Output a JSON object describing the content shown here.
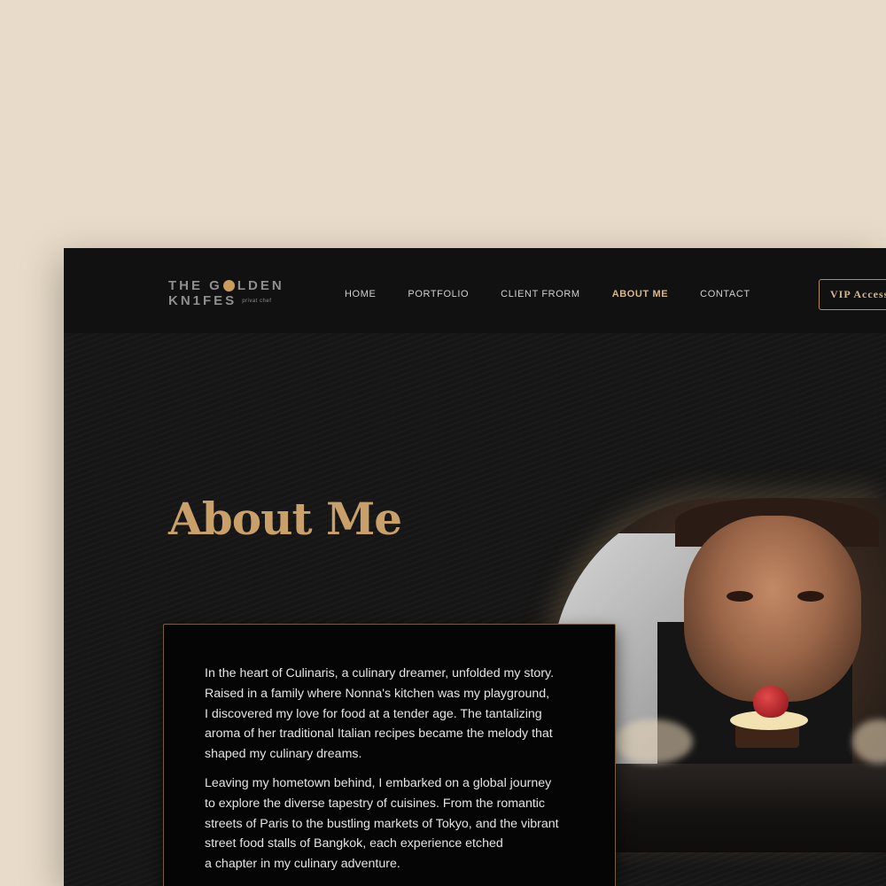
{
  "logo": {
    "line1_before": "THE G",
    "line1_after": "LDEN",
    "line2": "KN1FES",
    "subtitle": "privat chef"
  },
  "nav": {
    "items": [
      {
        "label": "HOME",
        "active": false
      },
      {
        "label": "PORTFOLIO",
        "active": false
      },
      {
        "label": "CLIENT FRORM",
        "active": false
      },
      {
        "label": "ABOUT ME",
        "active": true
      },
      {
        "label": "CONTACT",
        "active": false
      }
    ]
  },
  "vip_button": {
    "label": "VIP Access"
  },
  "main": {
    "title": "About Me",
    "paragraphs": [
      {
        "lines": [
          "In the heart of Culinaris, a culinary dreamer, unfolded my story.",
          "Raised in a family where Nonna's kitchen was my playground,",
          "I discovered my love for food at a tender age. The tantalizing",
          "aroma of her traditional Italian recipes became the melody that",
          "shaped my culinary dreams."
        ]
      },
      {
        "lines": [
          "Leaving my hometown behind, I embarked on a global journey",
          "to explore the diverse tapestry of cuisines. From the romantic",
          "streets of Paris to the bustling markets of Tokyo, and the vibrant",
          "street food stalls of Bangkok, each experience etched",
          "a chapter in my culinary adventure."
        ]
      }
    ]
  },
  "colors": {
    "page_background": "#e8dbc9",
    "window_background": "#151515",
    "header_background": "#111111",
    "accent_gold": "#c9a06a",
    "nav_text": "#cfcfcf",
    "body_text": "#e4e4e4"
  }
}
